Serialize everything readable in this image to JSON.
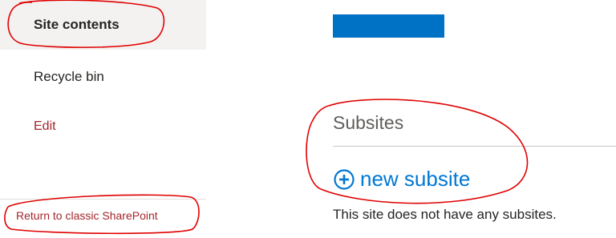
{
  "nav": {
    "items": [
      {
        "label": "Site contents",
        "selected": true
      },
      {
        "label": "Recycle bin"
      },
      {
        "label": "Edit"
      }
    ],
    "classic_link": "Return to classic SharePoint"
  },
  "main": {
    "section_title": "Subsites",
    "new_subsite_label": "new subsite",
    "new_subsite_icon": "add-circle-icon",
    "empty_message": "This site does not have any subsites."
  },
  "colors": {
    "header_bar": "#0072c6",
    "link_blue": "#0078d4",
    "nav_red": "#a4262c",
    "annotation": "#e00000"
  }
}
